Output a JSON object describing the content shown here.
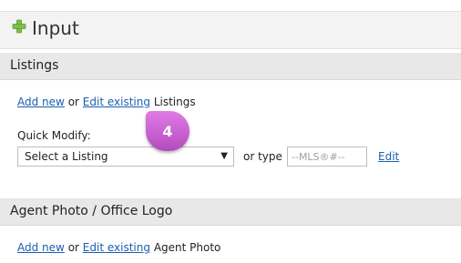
{
  "header": {
    "title": "Input"
  },
  "listings": {
    "section_title": "Listings",
    "add_new": "Add new",
    "or": "or",
    "edit_existing": "Edit existing",
    "suffix": "Listings",
    "quick_modify_label": "Quick Modify:",
    "select_value": "Select a Listing",
    "select_arrow": "▼",
    "or_type": "or type",
    "mls_placeholder": "--MLS®#--",
    "edit": "Edit"
  },
  "callout": {
    "number": "4"
  },
  "agent_photo": {
    "section_title": "Agent Photo / Office Logo",
    "add_new": "Add new",
    "or": "or",
    "edit_existing": "Edit existing",
    "suffix": "Agent Photo"
  },
  "colors": {
    "plus_icon": "#7cc04a",
    "link": "#1a5fb0",
    "badge": "#c45ad0"
  }
}
